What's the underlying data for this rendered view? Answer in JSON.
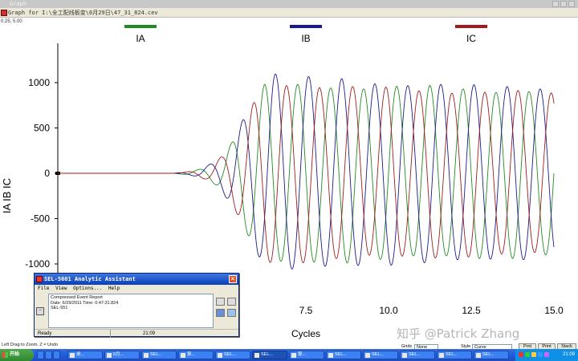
{
  "window": {
    "title": "Graph",
    "path": "Graph for I:\\全工配线板变\\6月29日\\47_31_824.cev",
    "zoom_readout": "0.25, 5.00"
  },
  "chart_data": {
    "type": "line",
    "x": [
      0,
      0.25,
      0.5,
      0.75,
      1,
      1.25,
      1.5,
      1.75,
      2,
      2.25,
      2.5,
      2.75,
      3,
      3.25,
      3.5,
      3.75,
      4,
      4.25,
      4.5,
      4.75,
      5,
      5.25,
      5.5,
      5.75,
      6,
      6.25,
      6.5,
      6.75,
      7,
      7.25,
      7.5,
      7.75,
      8,
      8.25,
      8.5,
      8.75,
      9,
      9.25,
      9.5,
      9.75,
      10,
      10.25,
      10.5,
      10.75,
      11,
      11.25,
      11.5,
      11.75,
      12,
      12.25,
      12.5,
      12.75,
      13,
      13.25,
      13.5,
      13.75,
      14,
      14.25,
      14.5,
      14.75,
      15
    ],
    "series": [
      {
        "name": "IA",
        "color": "#228b22",
        "phase_deg": 0,
        "values": [
          0,
          0,
          0,
          0,
          0,
          0,
          0,
          0,
          0,
          0,
          0,
          0,
          0,
          0,
          0,
          10,
          20,
          40,
          70,
          120,
          200,
          330,
          500,
          680,
          860,
          980,
          1000,
          970,
          950,
          980,
          1000,
          980,
          940,
          940,
          970,
          990,
          970,
          930,
          920,
          950,
          980,
          960,
          920,
          910,
          940,
          970,
          950,
          910,
          900,
          930,
          950,
          940,
          900,
          890,
          920,
          940,
          930,
          900,
          890,
          900,
          910
        ]
      },
      {
        "name": "IB",
        "color": "#1a1a8c",
        "phase_deg": 120,
        "values": [
          0,
          0,
          0,
          0,
          0,
          0,
          0,
          0,
          0,
          0,
          0,
          0,
          0,
          0,
          0,
          10,
          20,
          40,
          80,
          130,
          220,
          350,
          520,
          700,
          880,
          1000,
          1100,
          1080,
          1060,
          1050,
          1070,
          1060,
          1030,
          1020,
          1040,
          1050,
          1030,
          990,
          980,
          1000,
          1020,
          1000,
          970,
          960,
          980,
          1000,
          990,
          960,
          950,
          960,
          980,
          970,
          950,
          940,
          950,
          970,
          960,
          940,
          930,
          930,
          940
        ]
      },
      {
        "name": "IC",
        "color": "#a01c1c",
        "phase_deg": 240,
        "values": [
          0,
          0,
          0,
          0,
          0,
          0,
          0,
          0,
          0,
          0,
          0,
          0,
          0,
          0,
          0,
          10,
          20,
          40,
          70,
          120,
          200,
          330,
          500,
          660,
          830,
          950,
          1000,
          980,
          960,
          980,
          990,
          970,
          930,
          920,
          950,
          970,
          950,
          910,
          900,
          930,
          960,
          940,
          900,
          890,
          920,
          940,
          930,
          890,
          880,
          910,
          930,
          920,
          880,
          870,
          900,
          920,
          910,
          880,
          870,
          880,
          890
        ]
      }
    ],
    "notes": "Each series value is the sinusoid peak amplitude envelope (A) at that cycle; waveform is a 1-cycle-period sine with the stated phase offset.",
    "title": "",
    "xlabel": "Cycles",
    "ylabel": "IA IB IC",
    "xlim": [
      0,
      15
    ],
    "ylim": [
      -1200,
      1200
    ],
    "x_ticks": [
      "7.5",
      "10.0",
      "12.5",
      "15.0"
    ],
    "x_tick_values": [
      7.5,
      10,
      12.5,
      15
    ],
    "y_ticks": [
      "1000",
      "500",
      "0",
      "-500",
      "-1000"
    ],
    "y_tick_values": [
      1000,
      500,
      0,
      -500,
      -1000
    ],
    "legend_position": "top",
    "grid": false
  },
  "controls": {
    "grids_label": "Grids",
    "grids_value": "None",
    "style_label": "Style",
    "style_value": "Curve",
    "btn_prev": "Prnt",
    "btn_print": "Print",
    "btn_stack": "Stack"
  },
  "dialog": {
    "title": "SEL-5601 Analytic Assistant",
    "close": "×",
    "menu": [
      "File",
      "View",
      "Options...",
      "Help"
    ],
    "lines": [
      "Compressed Event Report",
      "Date: 6/29/2011  Time: 0:47:31.824",
      "SEL-551"
    ],
    "left_btn": "−",
    "status_ready": "Ready",
    "status_time": "21:09"
  },
  "hint": "Left Drag to Zoom, Z = Undo",
  "taskbar": {
    "start": "开始",
    "items": [
      "桌...",
      "6月...",
      "SEL...",
      "算...",
      "SEL...",
      "SEL...",
      "算...",
      "SEL...",
      "SEL...",
      "SEL...",
      "SEL...",
      "SEL..."
    ],
    "clock": "21:09"
  },
  "watermark": "知乎 @Patrick Zhang"
}
